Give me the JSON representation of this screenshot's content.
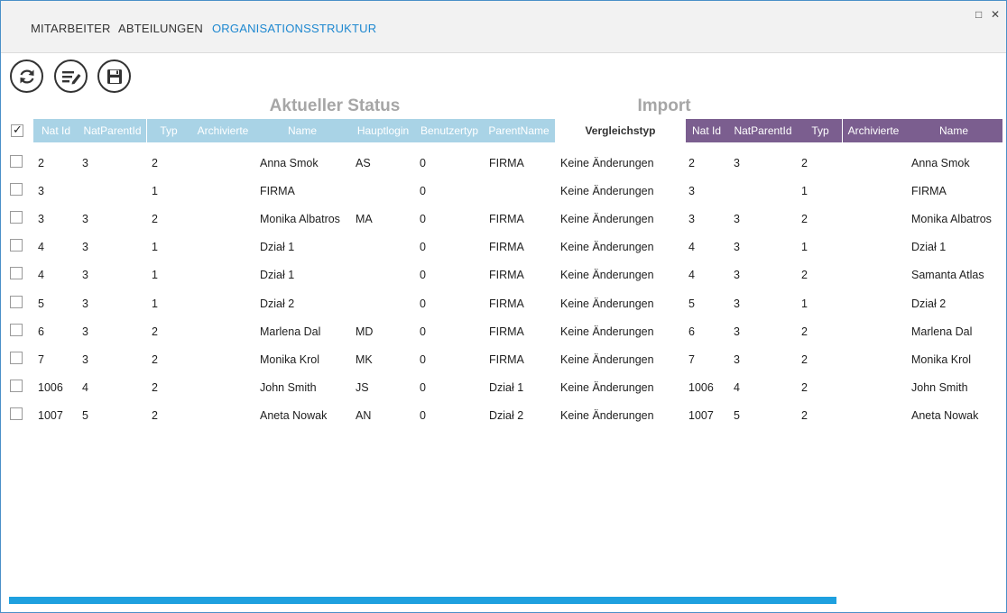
{
  "tabs": [
    {
      "label": "MITARBEITER",
      "active": false
    },
    {
      "label": "ABTEILUNGEN",
      "active": false
    },
    {
      "label": "ORGANISATIONSSTRUKTUR",
      "active": true
    }
  ],
  "window_controls": {
    "maximize": "□",
    "close": "✕"
  },
  "toolbar": [
    {
      "name": "refresh-icon"
    },
    {
      "name": "edit-list-icon"
    },
    {
      "name": "save-icon"
    }
  ],
  "sections": {
    "left_title": "Aktueller Status",
    "right_title": "Import"
  },
  "headers": {
    "current": [
      "Nat Id",
      "NatParentId",
      "Typ",
      "Archivierte",
      "Name",
      "Hauptlogin",
      "Benutzertyp",
      "ParentName"
    ],
    "compare": "Vergleichstyp",
    "import": [
      "Nat Id",
      "NatParentId",
      "Typ",
      "Archivierte",
      "Name"
    ]
  },
  "colors": {
    "current_header": "#a9d3e6",
    "import_header": "#7b5e8f",
    "accent": "#1e88d0",
    "progress": "#1ea0df"
  },
  "progress_fraction": 0.823,
  "rows": [
    {
      "cur": [
        "2",
        "3",
        "2",
        "",
        "Anna Smok",
        "AS",
        "0",
        "FIRMA"
      ],
      "cmp": "Keine Änderungen",
      "imp": [
        "2",
        "3",
        "2",
        "",
        "Anna Smok"
      ]
    },
    {
      "cur": [
        "3",
        "",
        "1",
        "",
        "FIRMA",
        "",
        "0",
        ""
      ],
      "cmp": "Keine Änderungen",
      "imp": [
        "3",
        "",
        "1",
        "",
        "FIRMA"
      ]
    },
    {
      "cur": [
        "3",
        "3",
        "2",
        "",
        "Monika Albatros",
        "MA",
        "0",
        "FIRMA"
      ],
      "cmp": "Keine Änderungen",
      "imp": [
        "3",
        "3",
        "2",
        "",
        "Monika Albatros"
      ]
    },
    {
      "cur": [
        "4",
        "3",
        "1",
        "",
        "Dział 1",
        "",
        "0",
        "FIRMA"
      ],
      "cmp": "Keine Änderungen",
      "imp": [
        "4",
        "3",
        "1",
        "",
        "Dział 1"
      ]
    },
    {
      "cur": [
        "4",
        "3",
        "1",
        "",
        "Dział 1",
        "",
        "0",
        "FIRMA"
      ],
      "cmp": "Keine Änderungen",
      "imp": [
        "4",
        "3",
        "2",
        "",
        "Samanta Atlas"
      ]
    },
    {
      "cur": [
        "5",
        "3",
        "1",
        "",
        "Dział 2",
        "",
        "0",
        "FIRMA"
      ],
      "cmp": "Keine Änderungen",
      "imp": [
        "5",
        "3",
        "1",
        "",
        "Dział 2"
      ]
    },
    {
      "cur": [
        "6",
        "3",
        "2",
        "",
        "Marlena Dal",
        "MD",
        "0",
        "FIRMA"
      ],
      "cmp": "Keine Änderungen",
      "imp": [
        "6",
        "3",
        "2",
        "",
        "Marlena Dal"
      ]
    },
    {
      "cur": [
        "7",
        "3",
        "2",
        "",
        "Monika Krol",
        "MK",
        "0",
        "FIRMA"
      ],
      "cmp": "Keine Änderungen",
      "imp": [
        "7",
        "3",
        "2",
        "",
        "Monika Krol"
      ]
    },
    {
      "cur": [
        "1006",
        "4",
        "2",
        "",
        "John Smith",
        "JS",
        "0",
        "Dział 1"
      ],
      "cmp": "Keine Änderungen",
      "imp": [
        "1006",
        "4",
        "2",
        "",
        "John Smith"
      ]
    },
    {
      "cur": [
        "1007",
        "5",
        "2",
        "",
        "Aneta Nowak",
        "AN",
        "0",
        "Dział 2"
      ],
      "cmp": "Keine Änderungen",
      "imp": [
        "1007",
        "5",
        "2",
        "",
        "Aneta Nowak"
      ]
    }
  ]
}
